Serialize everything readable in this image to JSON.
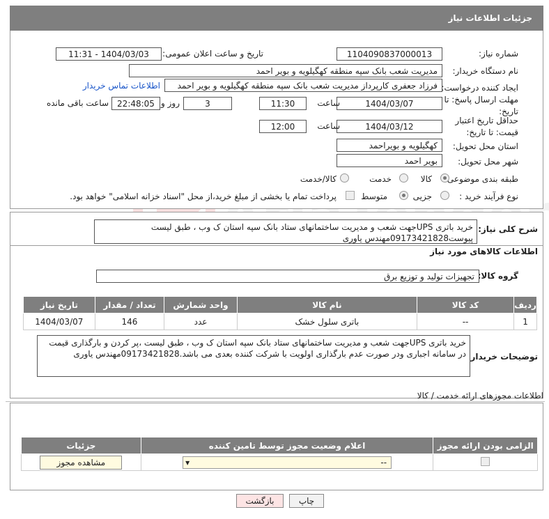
{
  "header": {
    "title": "جزئیات اطلاعات نیاز"
  },
  "fields": {
    "need_number_label": "شماره نیاز:",
    "need_number": "1104090837000013",
    "announce_label": "تاریخ و ساعت اعلان عمومی:",
    "announce_value": "1404/03/03 - 11:31",
    "buyer_org_label": "نام دستگاه خریدار:",
    "buyer_org": "مدیریت شعب بانک سپه منطقه کهگیلویه و بویر احمد",
    "creator_label": "ایجاد کننده درخواست:",
    "creator": "فرزاد جعفری کارپرداز مدیریت شعب بانک سپه منطقه کهگیلویه و بویر احمد",
    "contact_link": "اطلاعات تماس خریدار",
    "deadline_label": "مهلت ارسال پاسخ: تا تاریخ:",
    "deadline_date": "1404/03/07",
    "time_label": "ساعت",
    "deadline_time": "11:30",
    "days": "3",
    "days_label": "روز و",
    "remaining_time": "22:48:05",
    "remaining_label": "ساعت باقی مانده",
    "validity_label": "حداقل تاریخ اعتبار قیمت: تا تاریخ:",
    "validity_date": "1404/03/12",
    "validity_time": "12:00",
    "province_label": "استان محل تحویل:",
    "province": "کهگیلویه و بویراحمد",
    "city_label": "شهر محل تحویل:",
    "city": "بویر احمد",
    "category_label": "طبقه بندی موضوعی:",
    "cat_goods": "کالا",
    "cat_service": "خدمت",
    "cat_both": "کالا/خدمت",
    "process_label": "نوع فرآیند خرید :",
    "proc_partial": "جزیی",
    "proc_medium": "متوسط",
    "payment_note": "پرداخت تمام یا بخشی از مبلغ خرید،از محل \"اسناد خزانه اسلامی\" خواهد بود."
  },
  "summary": {
    "label": "شرح کلی نیاز:",
    "text": "خرید باتری UPSجهت شعب و مدیریت ساختمانهای ستاد بانک سپه استان ک وب ، طبق لیست پیوست09173421828مهندس یاوری"
  },
  "goods": {
    "section_title": "اطلاعات کالاهای مورد نیاز",
    "group_label": "گروه کالا:",
    "group_value": "تجهیزات تولید و توزیع برق",
    "columns": [
      "ردیف",
      "کد کالا",
      "نام کالا",
      "واحد شمارش",
      "تعداد / مقدار",
      "تاریخ نیاز"
    ],
    "rows": [
      {
        "row": "1",
        "code": "--",
        "name": "باتری سلول خشک",
        "unit": "عدد",
        "qty": "146",
        "date": "1404/03/07"
      }
    ]
  },
  "buyer_notes": {
    "label": "توضیحات خریدار:",
    "text": "خرید باتری UPSجهت شعب و مدیریت ساختمانهای ستاد بانک سپه استان ک وب ، طبق لیست ،پر کردن و بارگذاری قیمت در سامانه اجباری ودر صورت عدم بارگذاری اولویت با شرکت کننده بعدی می باشد.09173421828مهندس یاوری"
  },
  "permits": {
    "title": "اطلاعات مجوزهای ارائه خدمت / کالا",
    "columns": [
      "الزامی بودن ارائه مجوز",
      "اعلام وضعیت مجوز توسط تامین کننده",
      "جزئیات"
    ],
    "select_value": "--",
    "view_button": "مشاهده مجوز"
  },
  "actions": {
    "print": "چاپ",
    "back": "بازگشت"
  },
  "watermark": "AriaTender.neT"
}
